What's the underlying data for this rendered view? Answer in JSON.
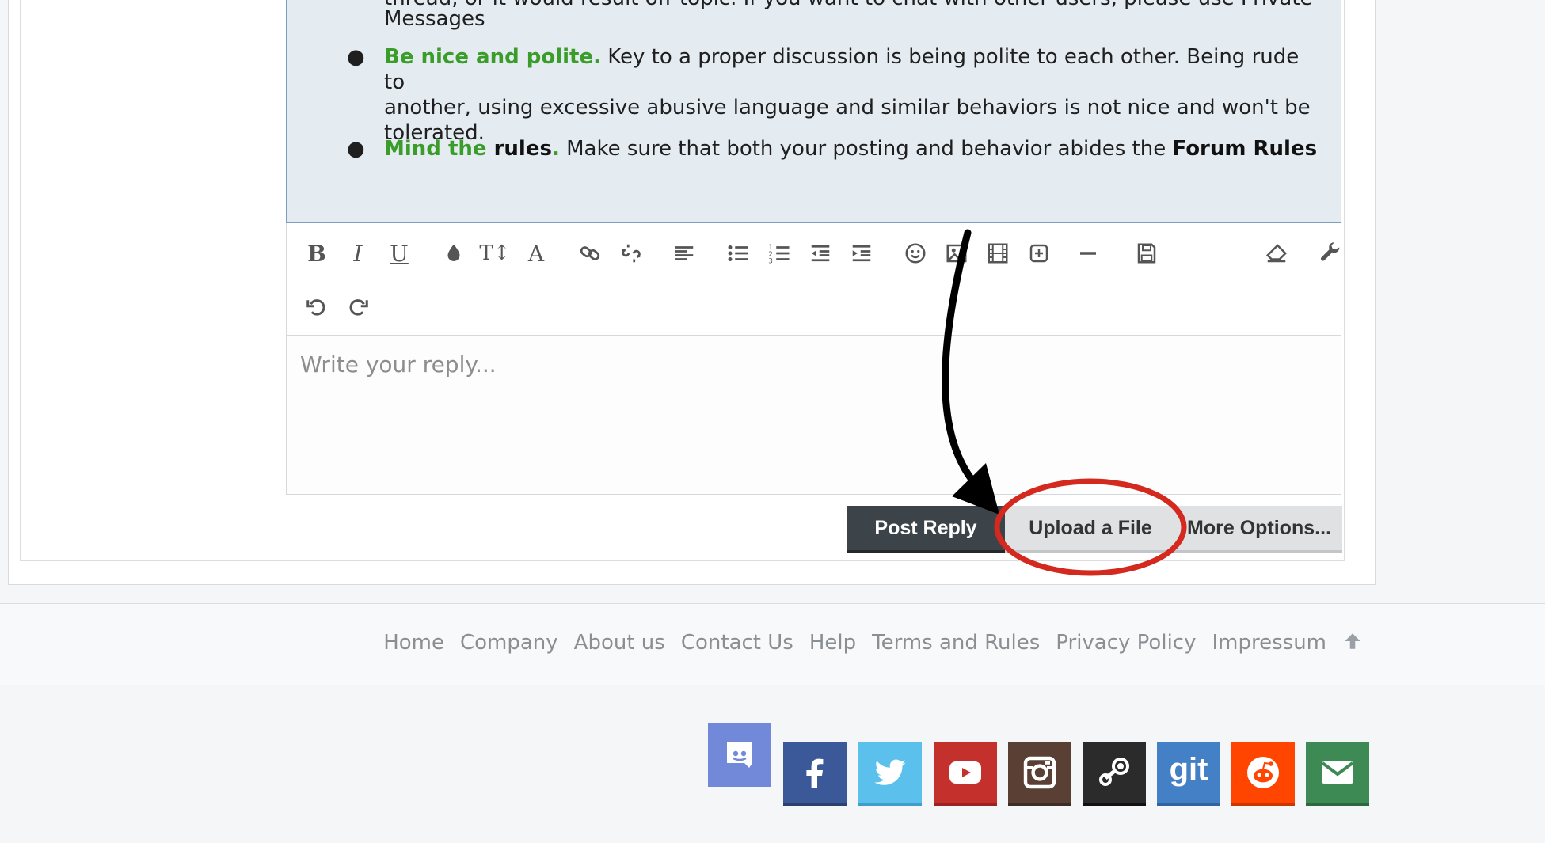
{
  "notice": {
    "top_line_1": "thread, or it would result off-topic. If you want to chat with other users, please use Private",
    "top_line_2": "Messages",
    "rules": [
      {
        "lead": "Be nice and polite.",
        "text_line_1": " Key to a proper discussion is being polite to each other. Being rude to",
        "text_line_2": "another, using excessive abusive language and similar behaviors is not nice and won't be",
        "text_line_3": "tolerated."
      },
      {
        "lead_green": "Mind the",
        "lead_bold": " rules",
        "lead_dot": ".",
        "text": " Make sure that both your posting and behavior abides the ",
        "link": "Forum Rules"
      }
    ]
  },
  "toolbar": {
    "bold": "B",
    "italic": "I",
    "underline": "U",
    "font_size": "T↕",
    "font_family": "A"
  },
  "reply": {
    "placeholder": "Write your reply..."
  },
  "buttons": {
    "post": "Post Reply",
    "upload": "Upload a File",
    "more": "More Options..."
  },
  "footer": {
    "links": [
      "Home",
      "Company",
      "About us",
      "Contact Us",
      "Help",
      "Terms and Rules",
      "Privacy Policy",
      "Impressum"
    ],
    "up_icon": "arrow-up-icon"
  },
  "social": {
    "git_label": "git",
    "colors": {
      "discord": "#7289da",
      "facebook": "#3b5998",
      "twitter": "#5bc0ec",
      "youtube": "#c4302b",
      "instagram": "#5a4034",
      "steam": "#2b2b2b",
      "git": "#4480c5",
      "reddit": "#ff4500",
      "email": "#3d8a55"
    }
  },
  "annotation": {
    "arrow_color": "#000000",
    "circle_color": "#d3291e"
  }
}
